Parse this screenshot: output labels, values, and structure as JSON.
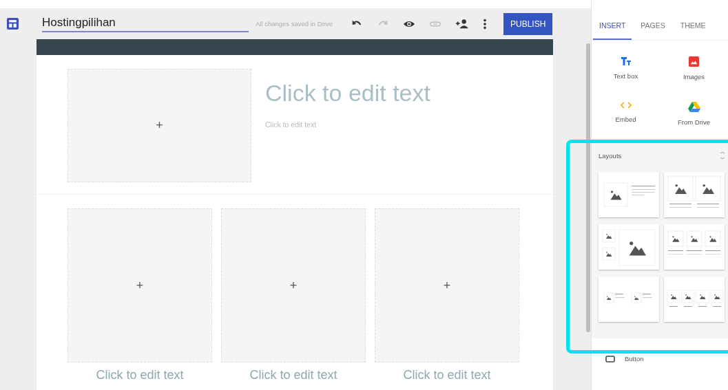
{
  "app": {
    "title": "Hostingpilihan",
    "save_status": "All changes saved in Drive",
    "publish": "PUBLISH"
  },
  "toolbar": [
    {
      "kind": "undo",
      "disabled": false
    },
    {
      "kind": "redo",
      "disabled": true
    },
    {
      "kind": "preview",
      "disabled": false
    },
    {
      "kind": "link",
      "disabled": true
    },
    {
      "kind": "share",
      "disabled": false
    },
    {
      "kind": "more",
      "disabled": false
    }
  ],
  "page": {
    "hero": {
      "placeholder": "+",
      "title": "Click to edit text",
      "body": "Click to edit text"
    },
    "columns": [
      {
        "placeholder": "+",
        "caption": "Click to edit text"
      },
      {
        "placeholder": "+",
        "caption": "Click to edit text"
      },
      {
        "placeholder": "+",
        "caption": "Click to edit text"
      }
    ]
  },
  "panel": {
    "tabs": [
      {
        "label": "INSERT",
        "selected": true
      },
      {
        "label": "PAGES",
        "selected": false
      },
      {
        "label": "THEME",
        "selected": false
      }
    ],
    "insert_items": [
      {
        "kind": "text",
        "label": "Text box"
      },
      {
        "kind": "images",
        "label": "Images"
      },
      {
        "kind": "embed",
        "label": "Embed"
      },
      {
        "kind": "drive",
        "label": "From Drive"
      }
    ],
    "layouts": {
      "title": "Layouts",
      "highlighted": true,
      "cards": [
        {
          "kind": "image-text"
        },
        {
          "kind": "two-images"
        },
        {
          "kind": "image-grid"
        },
        {
          "kind": "three-images"
        },
        {
          "kind": "two-image-text"
        },
        {
          "kind": "four-images"
        }
      ]
    },
    "items": [
      {
        "kind": "button",
        "label": "Button"
      }
    ]
  }
}
